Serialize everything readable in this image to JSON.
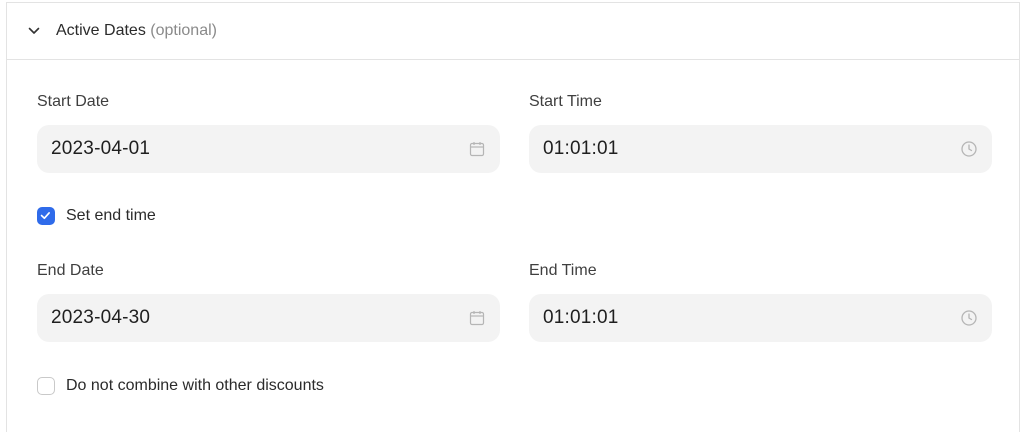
{
  "section": {
    "title": "Active Dates",
    "optional": "(optional)"
  },
  "start": {
    "date_label": "Start Date",
    "date_value": "2023-04-01",
    "time_label": "Start Time",
    "time_value": "01:01:01"
  },
  "end_toggle": {
    "label": "Set end time",
    "checked": true
  },
  "end": {
    "date_label": "End Date",
    "date_value": "2023-04-30",
    "time_label": "End Time",
    "time_value": "01:01:01"
  },
  "combine": {
    "label": "Do not combine with other discounts",
    "checked": false
  },
  "icons": {
    "collapse": "chevron-down-icon",
    "date": "calendar-icon",
    "time": "clock-icon",
    "check": "check-icon"
  },
  "colors": {
    "accent": "#2f6bea",
    "field_bg": "#f3f3f3",
    "border": "#e3e3e3",
    "muted_text": "#8a8a8a"
  }
}
